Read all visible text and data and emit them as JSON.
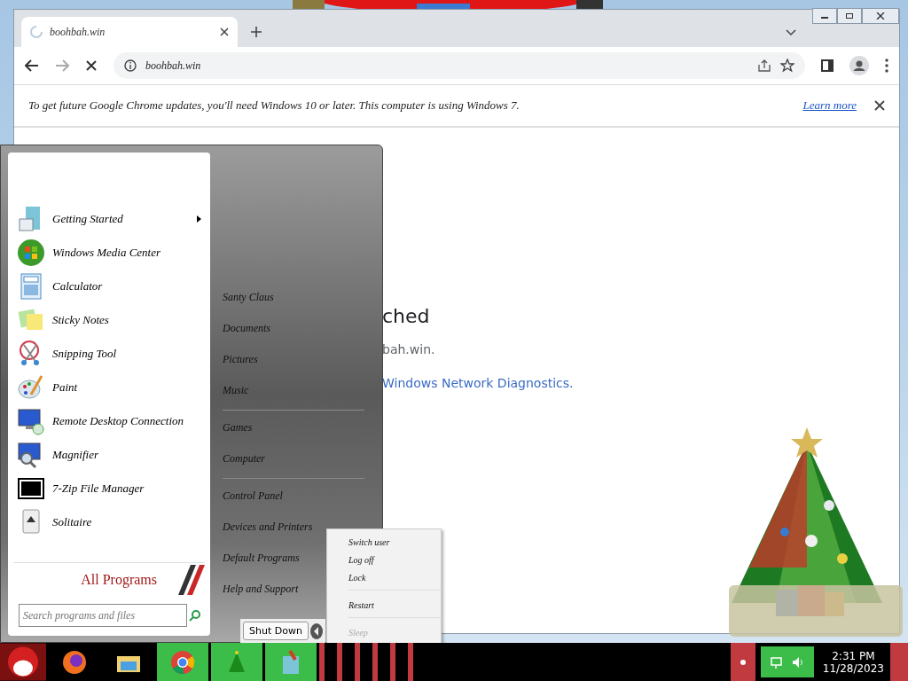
{
  "browser": {
    "tab": {
      "title": "boohbah.win",
      "loading": true
    },
    "address": "boohbah.win",
    "banner": {
      "text": "To get future Google Chrome updates, you'll need Windows 10 or later. This computer is using Windows 7.",
      "link": "Learn more"
    },
    "page": {
      "heading": "ched",
      "line": "bah.win.",
      "link": "Windows Network Diagnostics."
    }
  },
  "start_menu": {
    "programs": [
      {
        "label": "Getting Started",
        "has_submenu": true
      },
      {
        "label": "Windows Media Center",
        "has_submenu": false
      },
      {
        "label": "Calculator",
        "has_submenu": false
      },
      {
        "label": "Sticky Notes",
        "has_submenu": false
      },
      {
        "label": "Snipping Tool",
        "has_submenu": false
      },
      {
        "label": "Paint",
        "has_submenu": false
      },
      {
        "label": "Remote Desktop Connection",
        "has_submenu": false
      },
      {
        "label": "Magnifier",
        "has_submenu": false
      },
      {
        "label": "7-Zip File Manager",
        "has_submenu": false
      },
      {
        "label": "Solitaire",
        "has_submenu": false
      }
    ],
    "all_programs": "All Programs",
    "search": {
      "placeholder": "Search programs and files"
    },
    "place_groups": [
      [
        "Santy Claus",
        "Documents",
        "Pictures",
        "Music"
      ],
      [
        "Games",
        "Computer"
      ],
      [
        "Control Panel",
        "Devices and Printers",
        "Default Programs",
        "Help and Support"
      ]
    ],
    "shutdown": "Shut Down",
    "power_groups": [
      [
        {
          "label": "Switch user",
          "disabled": false
        },
        {
          "label": "Log off",
          "disabled": false
        },
        {
          "label": "Lock",
          "disabled": false
        }
      ],
      [
        {
          "label": "Restart",
          "disabled": false
        }
      ],
      [
        {
          "label": "Sleep",
          "disabled": true
        }
      ]
    ]
  },
  "taskbar": {
    "time": "2:31 PM",
    "date": "11/28/2023"
  }
}
